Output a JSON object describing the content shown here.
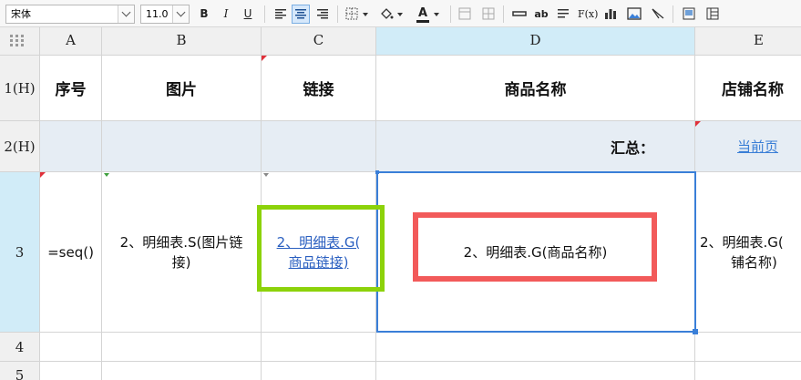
{
  "toolbar": {
    "font_name": "宋体",
    "font_size": "11.0",
    "bold": "B",
    "italic": "I",
    "underline": "U",
    "text_color_glyph": "A",
    "text_style_glyph": "ab",
    "formula_glyph": "F(x)"
  },
  "columns": [
    {
      "letter": "A"
    },
    {
      "letter": "B"
    },
    {
      "letter": "C"
    },
    {
      "letter": "D"
    },
    {
      "letter": "E"
    }
  ],
  "rows": [
    {
      "label": "1(H)"
    },
    {
      "label": "2(H)"
    },
    {
      "label": "3"
    },
    {
      "label": "4"
    },
    {
      "label": "5"
    }
  ],
  "header_row": {
    "a": "序号",
    "b": "图片",
    "c": "链接",
    "d": "商品名称",
    "e": "店铺名称"
  },
  "summary_row": {
    "d": "汇总：",
    "e": "当前页"
  },
  "data_row": {
    "a": "=seq()",
    "b_line1": "2、明细表.S(图片链",
    "b_line2": "接)",
    "c_line1": "2、明细表.G(",
    "c_line2": "商品链接)",
    "d": "2、明细表.G(商品名称)",
    "e_line1": "2、明细表.G(",
    "e_line2": "铺名称)"
  },
  "colors": {
    "selection_blue": "#3a7fd8",
    "highlight_green": "#8cd20a",
    "highlight_red": "#f25a5a"
  }
}
